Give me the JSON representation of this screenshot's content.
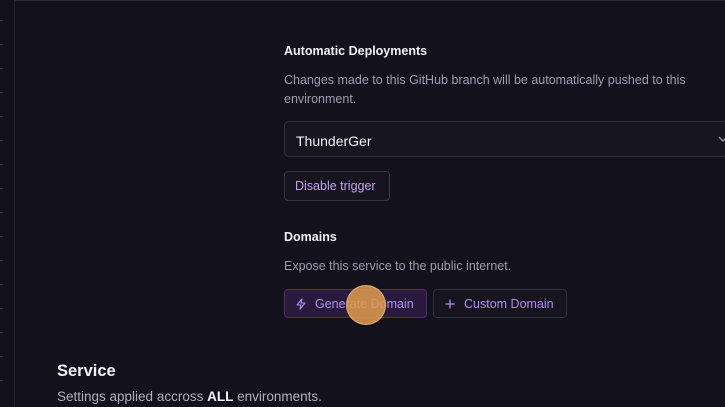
{
  "auto_deploy": {
    "heading": "Automatic Deployments",
    "description": "Changes made to this GitHub branch will be automatically pushed to this environment.",
    "branch_value": "ThunderGer",
    "disable_trigger_label": "Disable trigger"
  },
  "domains": {
    "heading": "Domains",
    "description": "Expose this service to the public internet.",
    "generate_label": "Generate Domain",
    "custom_label": "Custom Domain"
  },
  "service": {
    "title": "Service",
    "desc_before": "Settings applied accross ",
    "desc_bold": "ALL",
    "desc_after": " environments."
  },
  "icons": {
    "generate": "lightning-icon",
    "custom": "plus-icon",
    "branch_select": "chevron-down-icon"
  },
  "colors": {
    "background": "#13111c",
    "accent": "#b48bf0",
    "primary_button_bg": "#281a3b",
    "cursor": "#dd9a50"
  }
}
